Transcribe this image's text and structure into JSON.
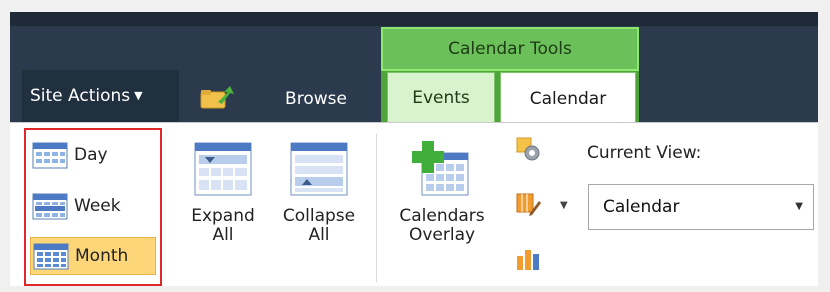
{
  "header": {
    "site_actions_label": "Site Actions",
    "browse_tab_label": "Browse",
    "context_group_label": "Calendar Tools",
    "tabs": [
      {
        "label": "Events"
      },
      {
        "label": "Calendar"
      }
    ]
  },
  "ribbon": {
    "scope": {
      "items": [
        {
          "label": "Day"
        },
        {
          "label": "Week"
        },
        {
          "label": "Month",
          "selected": true
        }
      ]
    },
    "expand": {
      "line1": "Expand",
      "line2": "All"
    },
    "collapse": {
      "line1": "Collapse",
      "line2": "All"
    },
    "overlay": {
      "line1": "Calendars",
      "line2": "Overlay"
    },
    "current_view": {
      "label": "Current View:",
      "value": "Calendar"
    }
  },
  "colors": {
    "topbar": "#2b3a4d",
    "contextual_green": "#6cc05a",
    "selected_scope": "#fcd679",
    "highlight_border": "#e0282a"
  },
  "icons": {
    "site_actions_caret": "chevron-down-icon",
    "up_folder": "navigate-up-icon",
    "day": "calendar-day-icon",
    "week": "calendar-week-icon",
    "month": "calendar-month-icon",
    "expand_all": "expand-all-icon",
    "collapse_all": "collapse-all-icon",
    "calendars_overlay": "calendars-overlay-icon",
    "gear": "settings-icon",
    "edit_columns": "edit-columns-icon",
    "chart": "chart-icon"
  }
}
